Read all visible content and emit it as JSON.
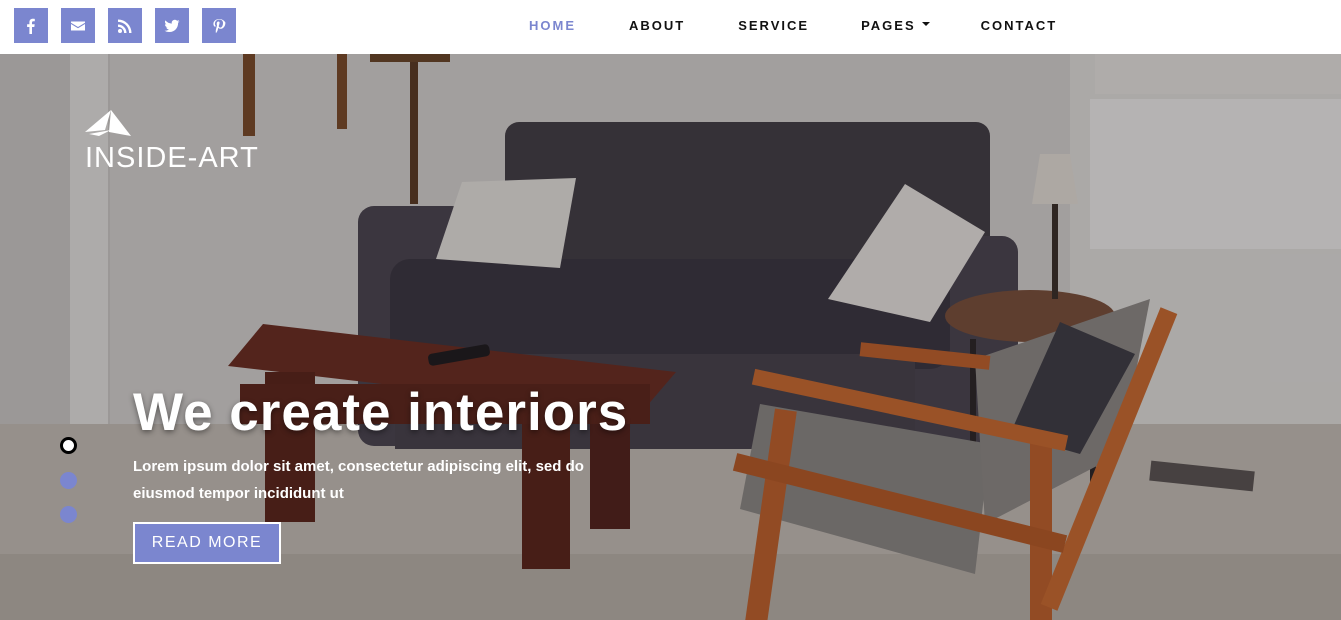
{
  "social": [
    {
      "name": "facebook",
      "icon": "facebook-icon"
    },
    {
      "name": "email",
      "icon": "email-icon"
    },
    {
      "name": "rss",
      "icon": "rss-icon"
    },
    {
      "name": "twitter",
      "icon": "twitter-icon"
    },
    {
      "name": "pinterest",
      "icon": "pinterest-icon"
    }
  ],
  "nav": {
    "home": "HOME",
    "about": "ABOUT",
    "service": "SERVICE",
    "pages": "PAGES",
    "contact": "CONTACT",
    "active": "HOME"
  },
  "brand": {
    "name": "INSIDE-ART",
    "logo_icon": "paper-plane-logo-icon"
  },
  "hero": {
    "headline": "We create interiors",
    "description": "Lorem ipsum dolor sit amet, consectetur adipiscing elit, sed do eiusmod tempor incididunt ut",
    "button_label": "READ MORE",
    "slides": 3,
    "active_slide": 1
  },
  "colors": {
    "accent": "#7b86cf",
    "text_dark": "#111111",
    "white": "#ffffff"
  }
}
